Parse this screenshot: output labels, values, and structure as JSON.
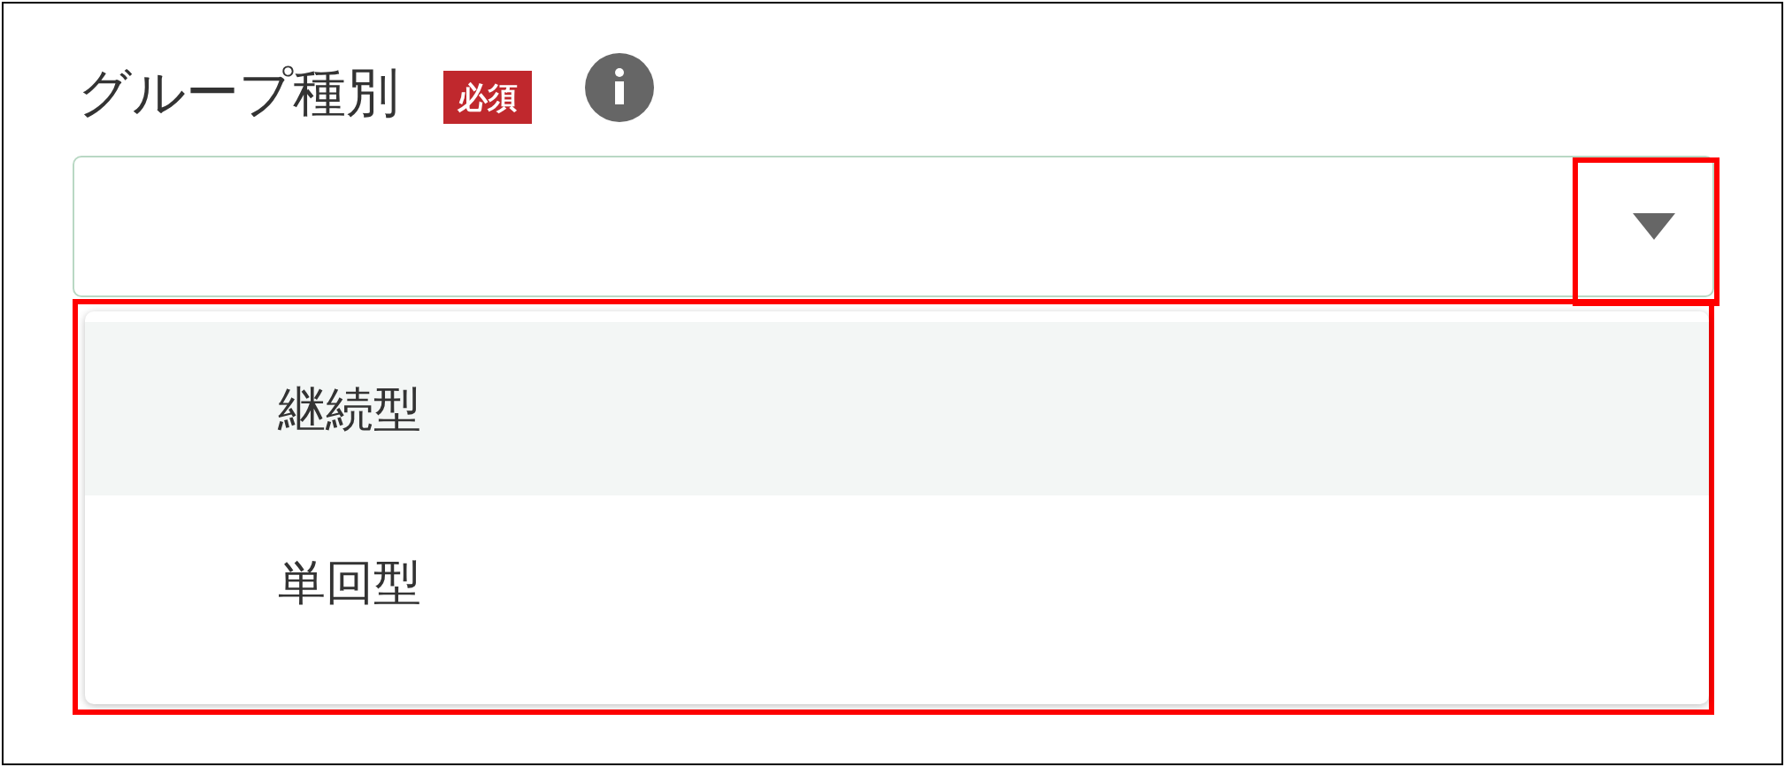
{
  "field": {
    "label": "グループ種別",
    "required_badge": "必須"
  },
  "select": {
    "expanded": true
  },
  "options": [
    {
      "label": "継続型",
      "selected": true
    },
    {
      "label": "単回型",
      "selected": false
    }
  ]
}
